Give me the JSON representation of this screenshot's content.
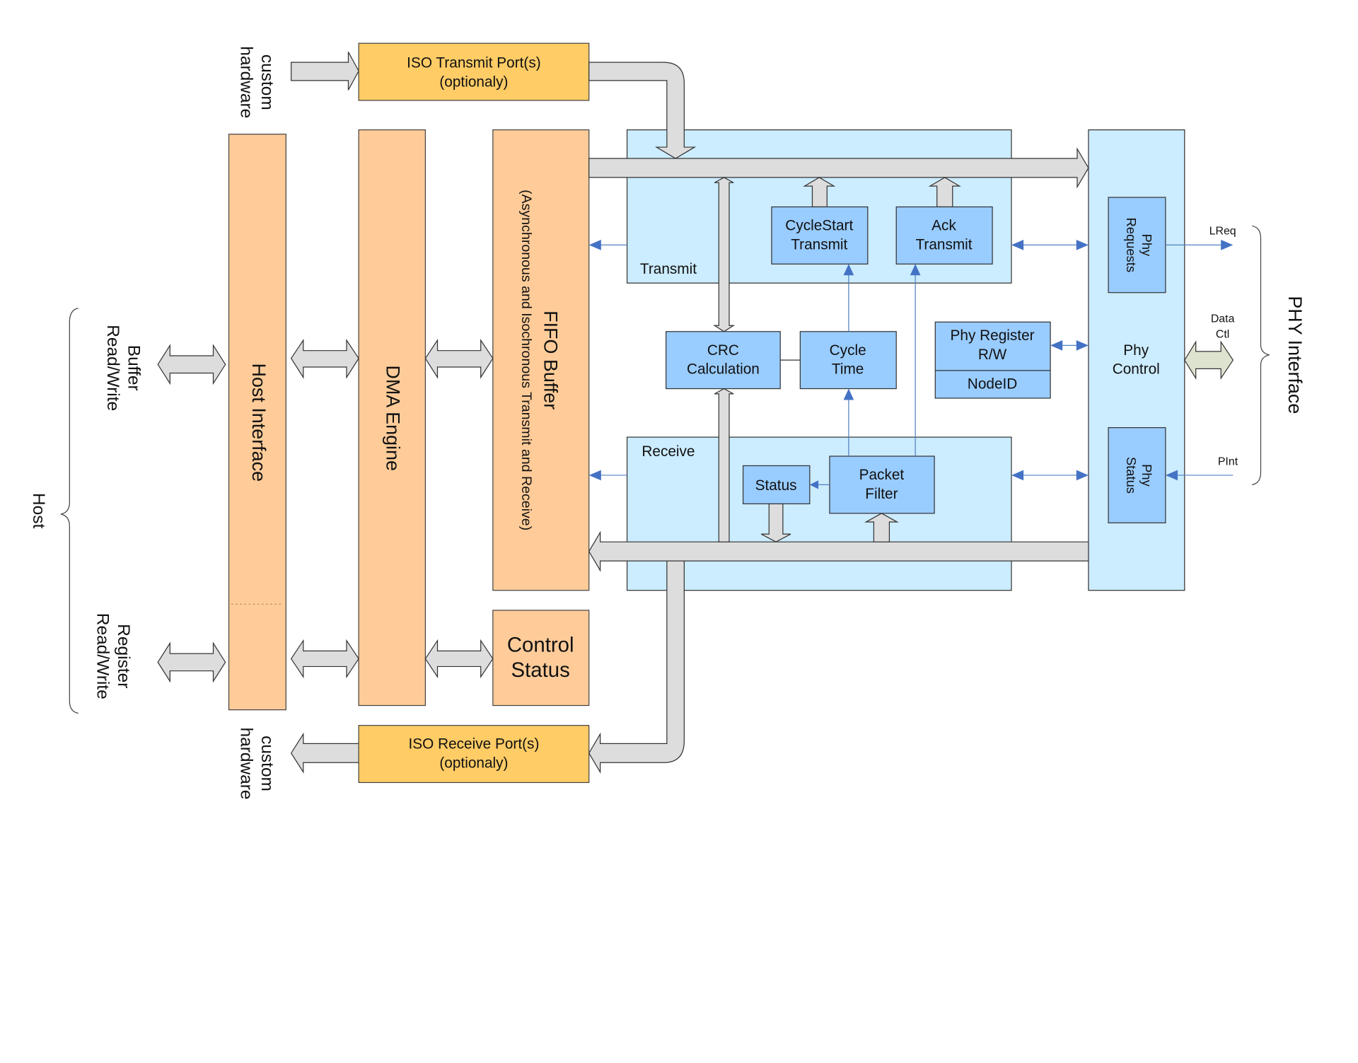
{
  "diagram": {
    "colors": {
      "host_blocks": "#FFCC99",
      "iso_ports": "#FFCC66",
      "link_region": "#CCECFF",
      "sub_blocks": "#99CCFF",
      "bus_pipe": "#DDDDDD",
      "signal": "#4472C4"
    },
    "left": {
      "host_group": "Host",
      "buffer_rw": [
        "Buffer",
        "Read/Write"
      ],
      "register_rw": [
        "Register",
        "Read/Write"
      ],
      "custom_hw_top": [
        "custom",
        "hardware"
      ],
      "custom_hw_bottom": [
        "custom",
        "hardware"
      ]
    },
    "blocks": {
      "host_interface": "Host Interface",
      "dma_engine": "DMA Engine",
      "fifo_title": "FIFO Buffer",
      "fifo_subtitle": "(Asynchronous and Isochronous Transmit and Receive)",
      "control_status": [
        "Control",
        "Status"
      ],
      "iso_transmit": [
        "ISO Transmit Port(s)",
        "(optionaly)"
      ],
      "iso_receive": [
        "ISO Receive Port(s)",
        "(optionaly)"
      ]
    },
    "transmit": {
      "label": "Transmit",
      "cyclestart": [
        "CycleStart",
        "Transmit"
      ],
      "ack": [
        "Ack",
        "Transmit"
      ]
    },
    "middle": {
      "crc": [
        "CRC",
        "Calculation"
      ],
      "cycle_time": [
        "Cycle",
        "Time"
      ],
      "phy_register": [
        "Phy Register",
        "R/W"
      ],
      "node_id": "NodeID"
    },
    "receive": {
      "label": "Receive",
      "status": "Status",
      "packet_filter": [
        "Packet",
        "Filter"
      ]
    },
    "phy": {
      "control": [
        "Phy",
        "Control"
      ],
      "requests": [
        "Phy",
        "Requests"
      ],
      "status": [
        "Phy",
        "Status"
      ],
      "lreq": "LReq",
      "data_ctl": [
        "Data",
        "Ctl"
      ],
      "pint": "PInt",
      "interface_group": "PHY Interface"
    }
  }
}
